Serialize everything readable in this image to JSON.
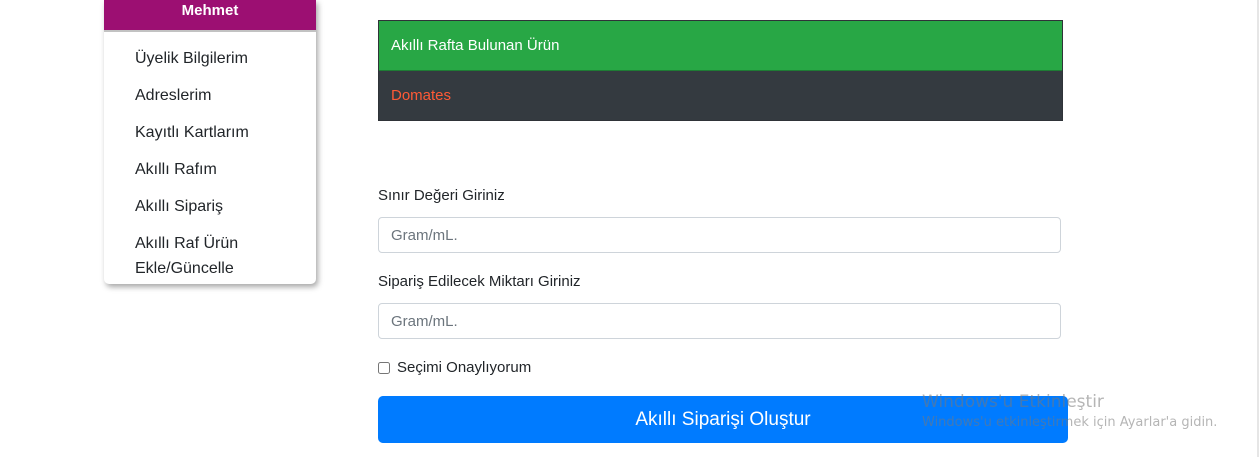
{
  "sidebar": {
    "user_name": "Mehmet",
    "items": [
      {
        "label": "Üyelik Bilgilerim"
      },
      {
        "label": "Adreslerim"
      },
      {
        "label": "Kayıtlı Kartlarım"
      },
      {
        "label": "Akıllı Rafım"
      },
      {
        "label": "Akıllı Sipariş"
      },
      {
        "label": "Akıllı Raf Ürün Ekle/Güncelle"
      }
    ]
  },
  "product_table": {
    "header": "Akıllı Rafta Bulunan Ürün",
    "rows": [
      {
        "name": "Domates"
      }
    ]
  },
  "form": {
    "threshold_label": "Sınır Değeri Giriniz",
    "threshold_placeholder": "Gram/mL.",
    "order_amount_label": "Sipariş Edilecek Miktarı Giriniz",
    "order_amount_placeholder": "Gram/mL.",
    "confirm_label": "Seçimi Onaylıyorum",
    "confirm_checked": false,
    "submit_label": "Akıllı Siparişi Oluştur"
  },
  "watermark": {
    "title": "Windows'u Etkinleştir",
    "subtitle": "Windows'u etkinleştirmek için Ayarlar'a gidin."
  },
  "colors": {
    "sidebar_header": "#9c0f72",
    "table_header": "#28a745",
    "table_row": "#343a40",
    "row_text": "#ff5a36",
    "primary_button": "#007bff"
  }
}
